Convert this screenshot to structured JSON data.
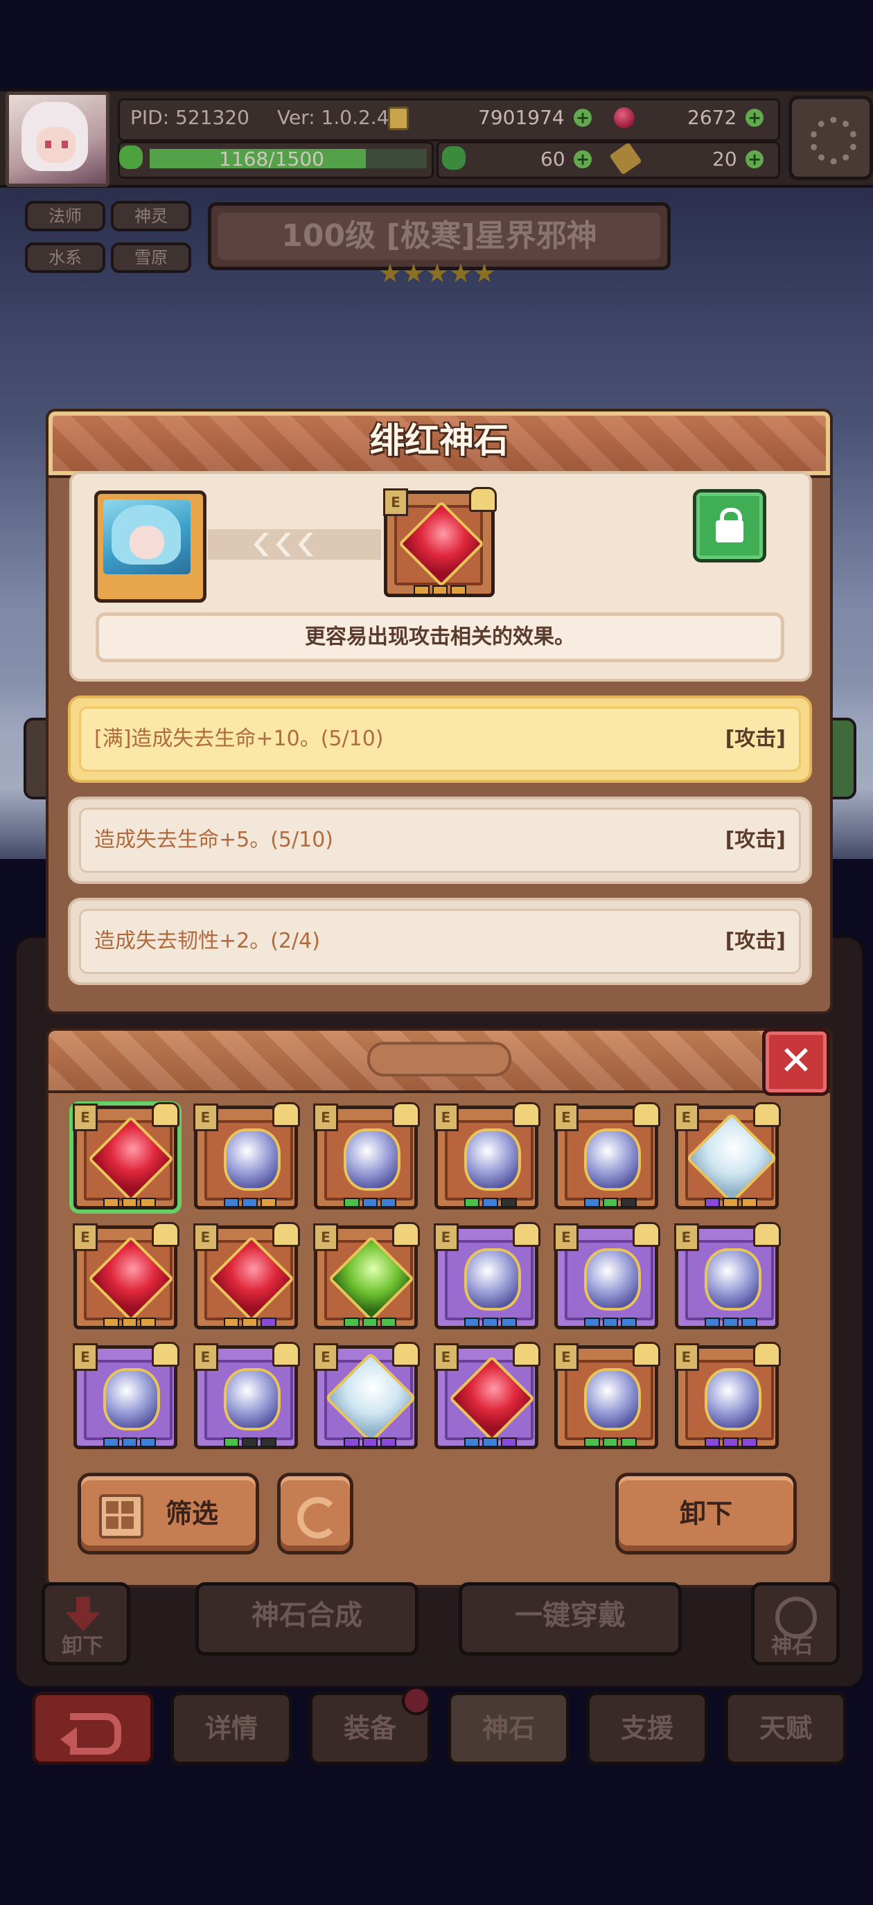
{
  "hud": {
    "pid": "PID: 521320",
    "version": "Ver: 1.0.2.4",
    "gold": "7901974",
    "gems": "2672",
    "stamina": "1168/1500",
    "stamina_fraction": 0.78,
    "clover": "60",
    "key": "20"
  },
  "hero": {
    "tags": [
      "法师",
      "神灵",
      "水系",
      "雪原"
    ],
    "title": "100级 [极寒]星界邪神",
    "stars": 5
  },
  "detail": {
    "title": "绯红神石",
    "description": "更容易出现攻击相关的效果。",
    "gem_badge": "E",
    "effects": [
      {
        "text": "[满]造成失去生命+10。(5/10)",
        "tag": "[攻击]",
        "active": true
      },
      {
        "text": "造成失去生命+5。(5/10)",
        "tag": "[攻击]",
        "active": false
      },
      {
        "text": "造成失去韧性+2。(2/4)",
        "tag": "[攻击]",
        "active": false
      }
    ]
  },
  "inventory": {
    "close_label": "✕",
    "badge": "E",
    "items": [
      {
        "gem": "red",
        "frame": "orange",
        "selected": true,
        "dots": [
          "#e0a040",
          "#e0a040",
          "#e0a040"
        ]
      },
      {
        "gem": "orb",
        "frame": "orange",
        "dots": [
          "#3f7fd6",
          "#3f7fd6",
          "#e0a040"
        ]
      },
      {
        "gem": "orb",
        "frame": "orange",
        "dots": [
          "#4cc04c",
          "#3f7fd6",
          "#3f7fd6"
        ]
      },
      {
        "gem": "orb",
        "frame": "orange",
        "dots": [
          "#4cc04c",
          "#3f7fd6",
          "#303030"
        ]
      },
      {
        "gem": "orb",
        "frame": "orange",
        "dots": [
          "#3f7fd6",
          "#4cc04c",
          "#303030"
        ]
      },
      {
        "gem": "white",
        "frame": "orange",
        "dots": [
          "#8a4ad6",
          "#e0a040",
          "#e0a040"
        ]
      },
      {
        "gem": "red",
        "frame": "orange",
        "dots": [
          "#e0a040",
          "#e0a040",
          "#e0a040"
        ]
      },
      {
        "gem": "red",
        "frame": "orange",
        "dots": [
          "#e0a040",
          "#e0a040",
          "#8a4ad6"
        ]
      },
      {
        "gem": "green",
        "frame": "orange",
        "dots": [
          "#4cc04c",
          "#4cc04c",
          "#4cc04c"
        ]
      },
      {
        "gem": "orb",
        "frame": "purple",
        "dots": [
          "#3f7fd6",
          "#3f7fd6",
          "#3f7fd6"
        ]
      },
      {
        "gem": "orb",
        "frame": "purple",
        "dots": [
          "#3f7fd6",
          "#3f7fd6",
          "#3f7fd6"
        ]
      },
      {
        "gem": "orb",
        "frame": "purple",
        "dots": [
          "#3f7fd6",
          "#3f7fd6",
          "#3f7fd6"
        ]
      },
      {
        "gem": "orb",
        "frame": "purple",
        "dots": [
          "#3f7fd6",
          "#3f7fd6",
          "#3f7fd6"
        ]
      },
      {
        "gem": "orb",
        "frame": "purple",
        "dots": [
          "#4cc04c",
          "#303030",
          "#303030"
        ]
      },
      {
        "gem": "white",
        "frame": "purple",
        "dots": [
          "#8a4ad6",
          "#8a4ad6",
          "#8a4ad6"
        ]
      },
      {
        "gem": "red",
        "frame": "purple",
        "dots": [
          "#3f7fd6",
          "#3f7fd6",
          "#8a4ad6"
        ]
      },
      {
        "gem": "orb",
        "frame": "orange",
        "dots": [
          "#4cc04c",
          "#4cc04c",
          "#4cc04c"
        ]
      },
      {
        "gem": "orb",
        "frame": "orange",
        "dots": [
          "#8a4ad6",
          "#8a4ad6",
          "#8a4ad6"
        ]
      }
    ],
    "filter_label": "筛选",
    "unequip_label": "卸下"
  },
  "bottom": {
    "left_label": "卸下",
    "right_label": "神石",
    "synth_label": "神石合成",
    "equip_all_label": "一键穿戴",
    "tabs": [
      "详情",
      "装备",
      "神石",
      "支援",
      "天赋"
    ]
  }
}
